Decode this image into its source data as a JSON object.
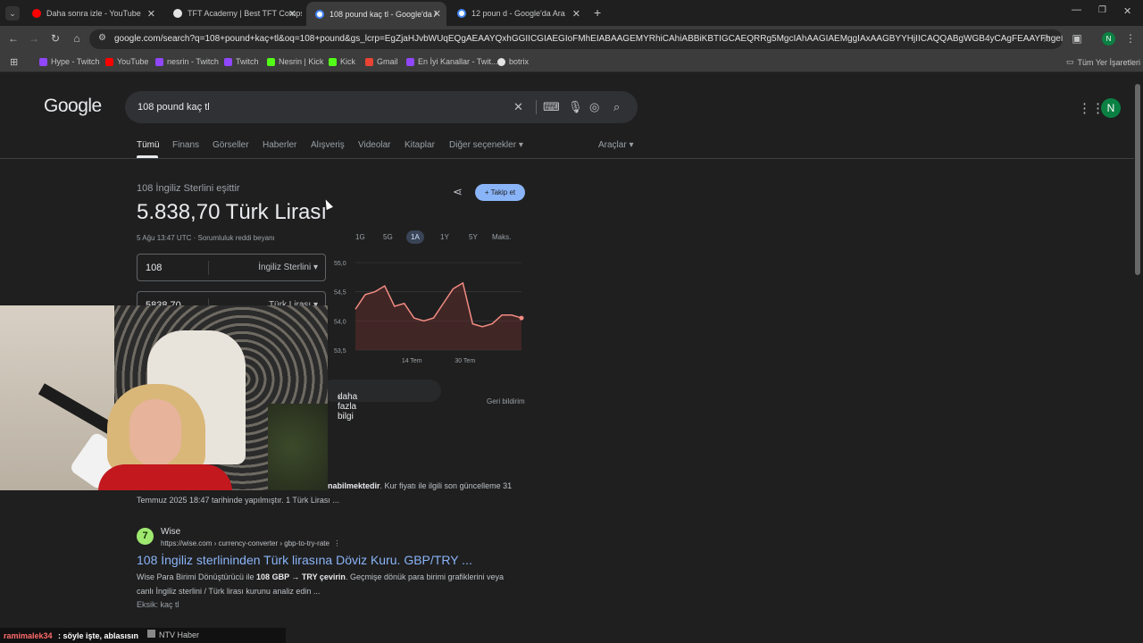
{
  "tabs": [
    {
      "title": "Daha sonra izle - YouTube",
      "color": "#ff0000"
    },
    {
      "title": "TFT Academy | Best TFT Comps",
      "color": "#e3e3e3"
    },
    {
      "title": "108 pound kaç tl - Google'da Ara",
      "color": "#4285f4"
    },
    {
      "title": "12 poun d - Google'da Ara",
      "color": "#4285f4"
    }
  ],
  "toolbar": {
    "url": "google.com/search?q=108+pound+kaç+tl&oq=108+pound&gs_lcrp=EgZjaHJvbWUqEQgAEAAYQxhGGIICGIAEGIoFMhEIABAAGEMYRhiCAhiABBiKBTIGCAEQRRg5MgcIAhAAGIAEMggIAxAAGBYYHjIICAQQABgWGB4yCAgFEAAYFhgeMggIBhAAGBYYHj...",
    "profile_initial": "N"
  },
  "bookmarks": [
    {
      "label": "Hype - Twitch",
      "color": "#9146ff"
    },
    {
      "label": "YouTube",
      "color": "#ff0000"
    },
    {
      "label": "nesrin - Twitch",
      "color": "#9146ff"
    },
    {
      "label": "Twitch",
      "color": "#9146ff"
    },
    {
      "label": "Nesrin | Kick",
      "color": "#53fc18"
    },
    {
      "label": "Kick",
      "color": "#53fc18"
    },
    {
      "label": "Gmail",
      "color": "#ea4335"
    },
    {
      "label": "En İyi Kanallar - Twit...",
      "color": "#9146ff"
    },
    {
      "label": "botrix",
      "color": "#e3e3e3"
    }
  ],
  "bookmarks_all": "Tüm Yer İşaretleri",
  "google": {
    "logo": "Google",
    "query": "108 pound kaç tl",
    "avatar": "N",
    "nav": [
      "Tümü",
      "Finans",
      "Görseller",
      "Haberler",
      "Alışveriş",
      "Videolar",
      "Kitaplar",
      "Diğer seçenekler ▾"
    ],
    "tools": "Araçlar ▾"
  },
  "converter": {
    "equals_label": "108 İngiliz Sterlini eşittir",
    "result": "5.838,70 Türk Lirası",
    "timestamp": "5 Ağu 13:47 UTC · Sorumluluk reddi beyanı",
    "follow": "+ Takip et",
    "ranges": [
      "1G",
      "5G",
      "1A",
      "1Y",
      "5Y",
      "Maks."
    ],
    "selected_range": "1A",
    "from_value": "108",
    "from_unit": "İngiliz Sterlini",
    "to_value": "5838,70",
    "to_unit": "Türk Lirası",
    "more_info": "daha fazla bilgi",
    "feedback": "Geri bildirim"
  },
  "chart_data": {
    "type": "line",
    "yticks": [
      "55,0",
      "54,5",
      "54,0",
      "53,5"
    ],
    "ylim": [
      53.5,
      55.0
    ],
    "xticks": [
      "14 Tem",
      "30 Tem"
    ],
    "values": [
      54.2,
      54.45,
      54.5,
      54.6,
      54.25,
      54.3,
      54.05,
      54.0,
      54.05,
      54.3,
      54.55,
      54.65,
      53.95,
      53.9,
      53.95,
      54.1,
      54.1,
      54.05
    ],
    "line_color": "#f28b82"
  },
  "results": {
    "snippet1_bold": "nabilmektedir",
    "snippet1_rest": ". Kur fiyatı ile ilgili son güncelleme 31",
    "snippet1_line2": "Temmuz 2025 18:47 tarihinde yapılmıştır. 1 Türk Lirası ...",
    "wise_name": "Wise",
    "wise_favicon": "7",
    "wise_url": "https://wise.com › currency-converter › gbp-to-try-rate",
    "wise_title": "108 İngiliz sterlininden Türk lirasına Döviz Kuru. GBP/TRY ...",
    "wise_snip_a": "Wise Para Birimi Dönüştürücü ile ",
    "wise_snip_b": "108 GBP → TRY çevirin",
    "wise_snip_c": ". Geçmişe dönük para birimi grafiklerini veya",
    "wise_snip2": "canlı İngiliz sterlini / Türk lirası kurunu analiz edin ...",
    "wise_missing": "Eksik: kaç tl"
  },
  "chat": {
    "user": "ramimalek34",
    "message": ": söyle işte, ablasısın",
    "ntv": "NTV Haber"
  }
}
